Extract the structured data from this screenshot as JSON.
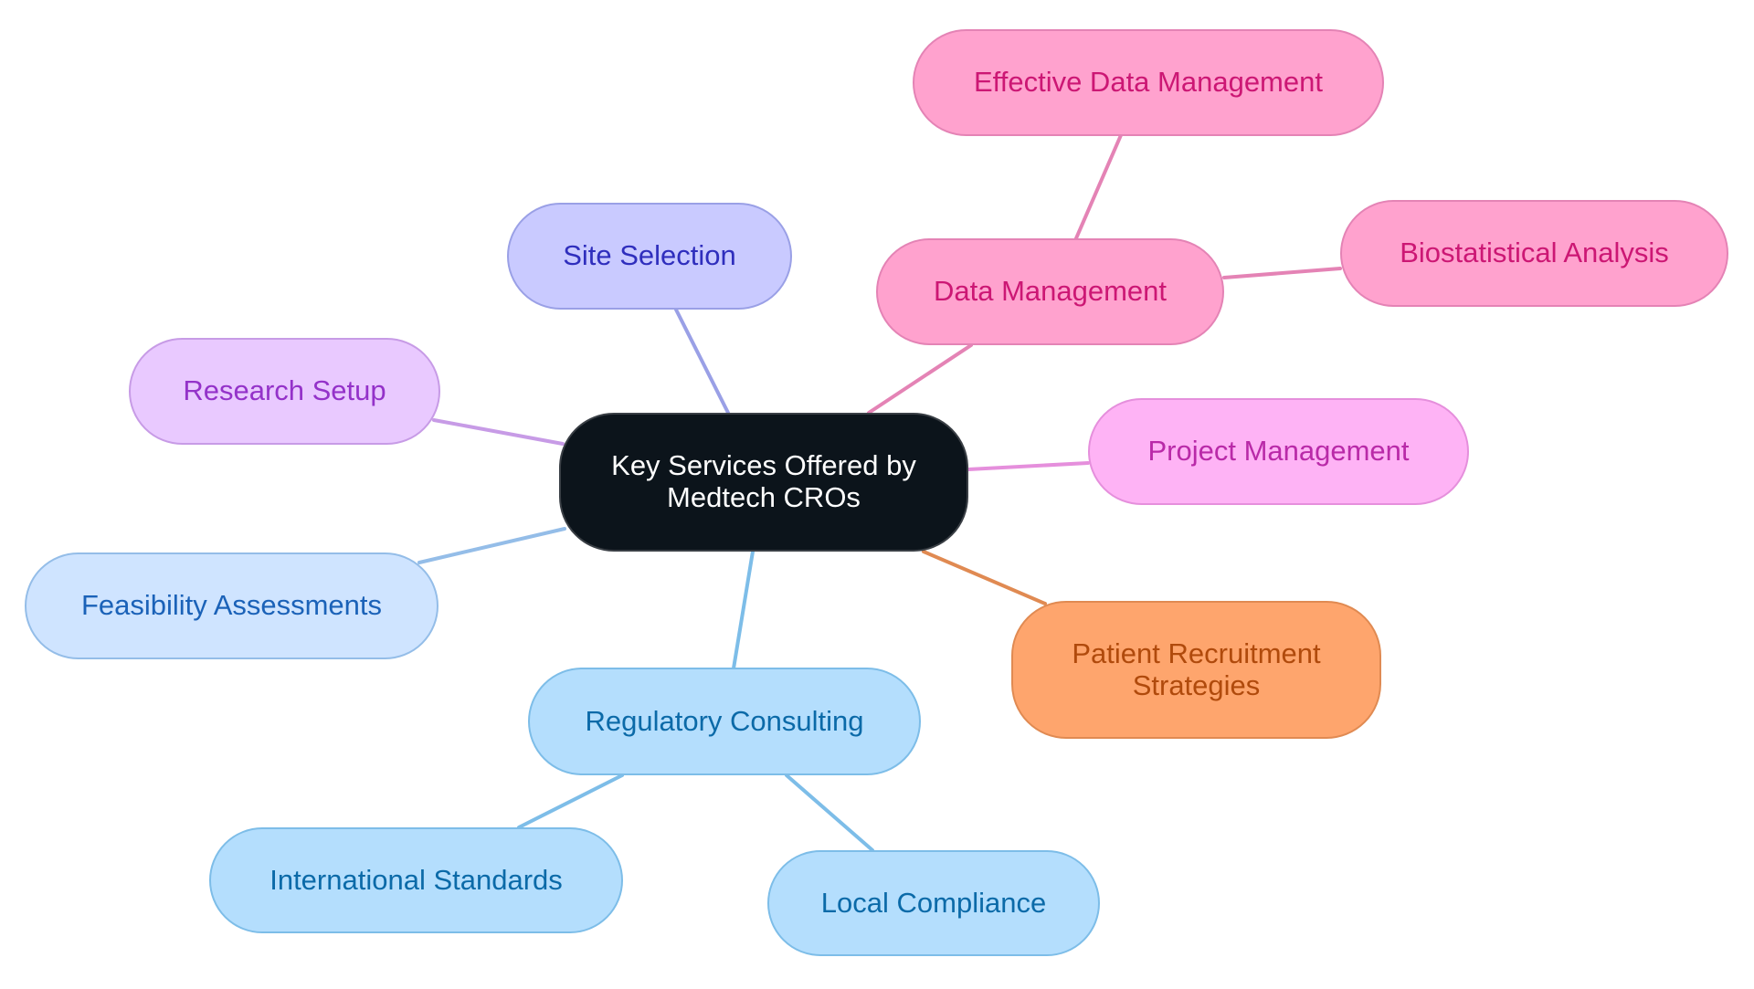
{
  "diagram": {
    "type": "mindmap",
    "root": {
      "id": "center",
      "label": "Key Services Offered by\nMedtech CROs",
      "color": "#0c141b"
    },
    "nodes": {
      "site": {
        "label": "Site Selection",
        "color": "#c9caff",
        "edge_color": "#9aa0e6"
      },
      "research": {
        "label": "Research Setup",
        "color": "#e9c9ff",
        "edge_color": "#c79be6"
      },
      "feas": {
        "label": "Feasibility Assessments",
        "color": "#cfe4ff",
        "edge_color": "#94bde8"
      },
      "reg": {
        "label": "Regulatory Consulting",
        "color": "#b4defd",
        "edge_color": "#7dbde8"
      },
      "intl": {
        "label": "International Standards",
        "color": "#b4defd",
        "edge_color": "#7dbde8"
      },
      "local": {
        "label": "Local Compliance",
        "color": "#b4defd",
        "edge_color": "#7dbde8"
      },
      "patient": {
        "label": "Patient Recruitment\nStrategies",
        "color": "#fea56d",
        "edge_color": "#e08a52"
      },
      "project": {
        "label": "Project Management",
        "color": "#feb3f5",
        "edge_color": "#e58fdc"
      },
      "data": {
        "label": "Data Management",
        "color": "#ffa2ce",
        "edge_color": "#e483b5"
      },
      "effective": {
        "label": "Effective Data Management",
        "color": "#ffa2ce",
        "edge_color": "#e483b5"
      },
      "bio": {
        "label": "Biostatistical Analysis",
        "color": "#ffa2ce",
        "edge_color": "#e483b5"
      }
    },
    "edges": [
      {
        "from": "center",
        "to": "site"
      },
      {
        "from": "center",
        "to": "research"
      },
      {
        "from": "center",
        "to": "feas"
      },
      {
        "from": "center",
        "to": "reg"
      },
      {
        "from": "center",
        "to": "patient"
      },
      {
        "from": "center",
        "to": "project"
      },
      {
        "from": "center",
        "to": "data"
      },
      {
        "from": "data",
        "to": "effective"
      },
      {
        "from": "data",
        "to": "bio"
      },
      {
        "from": "reg",
        "to": "intl"
      },
      {
        "from": "reg",
        "to": "local"
      }
    ]
  }
}
